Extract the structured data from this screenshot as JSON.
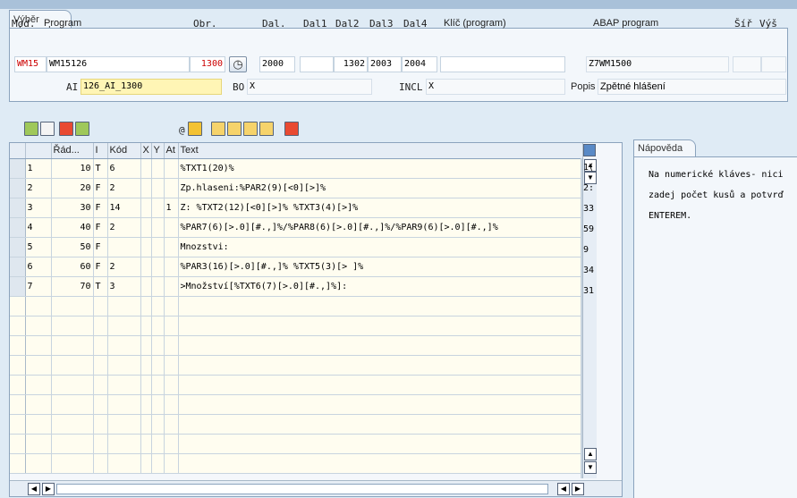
{
  "header_tab": "Výběr obrazovky",
  "labels": {
    "mod": "Mod.",
    "program": "Program",
    "obr": "Obr.",
    "dal": "Dal.",
    "dal1": "Dal1",
    "dal2": "Dal2",
    "dal3": "Dal3",
    "dal4": "Dal4",
    "klic": "Klíč (program)",
    "abap": "ABAP program",
    "sir": "Šíř",
    "vys": "Výš",
    "ai": "AI",
    "bo": "BO",
    "incl": "INCL",
    "popis": "Popis"
  },
  "fields": {
    "mod": "WM15",
    "program": "WM15126",
    "obr": "1300",
    "dal": "2000",
    "dal1": "",
    "dal2": "1302",
    "dal3": "2003",
    "dal4": "2004",
    "klic": "",
    "abap": "Z7WM1500",
    "sir": "",
    "vys": "",
    "ai": "126_AI_1300",
    "bo": "X",
    "incl": "X",
    "popis": "Zpětné hlášení"
  },
  "toolbar_mid_label": "@",
  "table": {
    "columns": [
      "Řád...",
      "I",
      "Kód",
      "X",
      "Y",
      "At",
      "Text"
    ],
    "rows": [
      {
        "n": "1",
        "rad": "10",
        "i": "T",
        "kod": "6",
        "x": "",
        "y": "",
        "at": "",
        "text": "%TXT1(20)%",
        "last": "1("
      },
      {
        "n": "2",
        "rad": "20",
        "i": "F",
        "kod": "2",
        "x": "",
        "y": "",
        "at": "",
        "text": "Zp.hlaseni:%PAR2(9)[<0][>]%",
        "last": "2:"
      },
      {
        "n": "3",
        "rad": "30",
        "i": "F",
        "kod": "14",
        "x": "",
        "y": "",
        "at": "1",
        "text": "Z: %TXT2(12)[<0][>]% %TXT3(4)[>]%",
        "last": "33"
      },
      {
        "n": "4",
        "rad": "40",
        "i": "F",
        "kod": "2",
        "x": "",
        "y": "",
        "at": "",
        "text": "%PAR7(6)[>.0][#.,]%/%PAR8(6)[>.0][#.,]%/%PAR9(6)[>.0][#.,]%",
        "last": "59"
      },
      {
        "n": "5",
        "rad": "50",
        "i": "F",
        "kod": "",
        "x": "",
        "y": "",
        "at": "",
        "text": "Mnozstvi:",
        "last": "9"
      },
      {
        "n": "6",
        "rad": "60",
        "i": "F",
        "kod": "2",
        "x": "",
        "y": "",
        "at": "",
        "text": "%PAR3(16)[>.0][#.,]% %TXT5(3)[> ]%",
        "last": "34"
      },
      {
        "n": "7",
        "rad": "70",
        "i": "T",
        "kod": "3",
        "x": "",
        "y": "",
        "at": "",
        "text": ">Množství[%TXT6(7)[>.0][#.,]%]:",
        "last": "31"
      }
    ]
  },
  "help": {
    "tab": "Nápověda",
    "text": "Na numerické kláves- nici zadej počet kusů a potvrď ENTEREM."
  }
}
